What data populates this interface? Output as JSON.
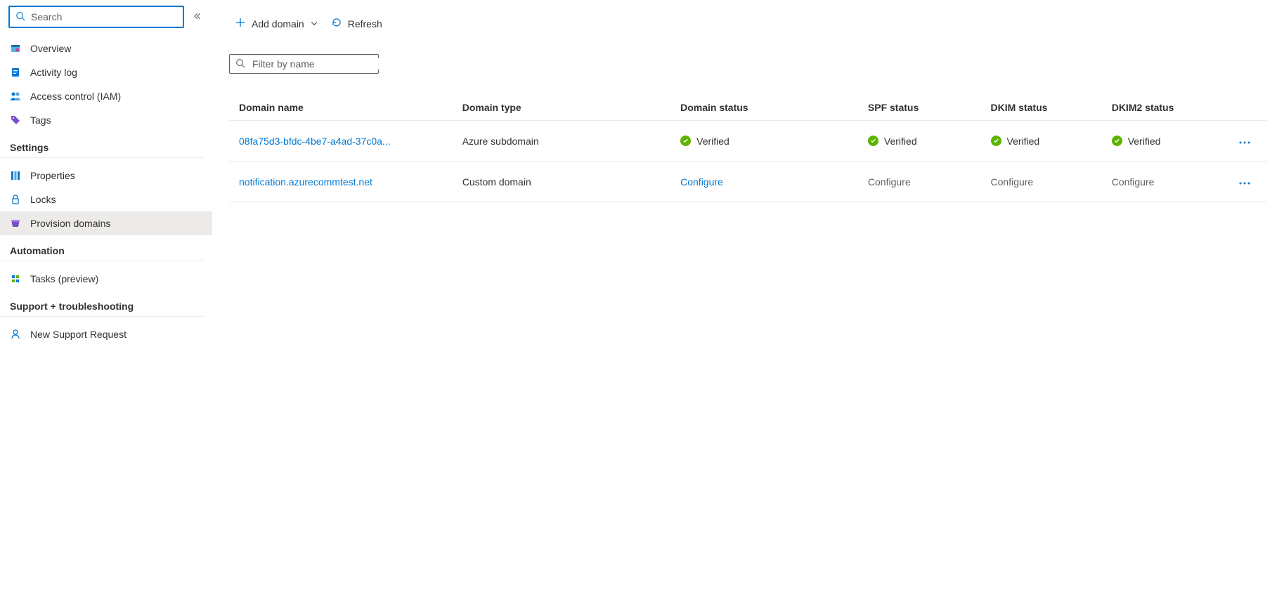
{
  "sidebar": {
    "search_placeholder": "Search",
    "top_items": [
      {
        "label": "Overview",
        "icon": "overview"
      },
      {
        "label": "Activity log",
        "icon": "log"
      },
      {
        "label": "Access control (IAM)",
        "icon": "iam"
      },
      {
        "label": "Tags",
        "icon": "tag"
      }
    ],
    "groups": [
      {
        "title": "Settings",
        "items": [
          {
            "label": "Properties",
            "icon": "properties"
          },
          {
            "label": "Locks",
            "icon": "lock"
          },
          {
            "label": "Provision domains",
            "icon": "domain",
            "active": true
          }
        ]
      },
      {
        "title": "Automation",
        "items": [
          {
            "label": "Tasks (preview)",
            "icon": "tasks"
          }
        ]
      },
      {
        "title": "Support + troubleshooting",
        "items": [
          {
            "label": "New Support Request",
            "icon": "support"
          }
        ]
      }
    ]
  },
  "toolbar": {
    "add_domain": "Add domain",
    "refresh": "Refresh"
  },
  "filter_placeholder": "Filter by name",
  "table": {
    "headers": {
      "name": "Domain name",
      "type": "Domain type",
      "domain_status": "Domain status",
      "spf": "SPF status",
      "dkim": "DKIM status",
      "dkim2": "DKIM2 status"
    },
    "rows": [
      {
        "name": "08fa75d3-bfdc-4be7-a4ad-37c0a...",
        "type": "Azure subdomain",
        "domain_status": {
          "label": "Verified",
          "kind": "verified"
        },
        "spf": {
          "label": "Verified",
          "kind": "verified"
        },
        "dkim": {
          "label": "Verified",
          "kind": "verified"
        },
        "dkim2": {
          "label": "Verified",
          "kind": "verified"
        }
      },
      {
        "name": "notification.azurecommtest.net",
        "type": "Custom domain",
        "domain_status": {
          "label": "Configure",
          "kind": "configure_link"
        },
        "spf": {
          "label": "Configure",
          "kind": "configure_muted"
        },
        "dkim": {
          "label": "Configure",
          "kind": "configure_muted"
        },
        "dkim2": {
          "label": "Configure",
          "kind": "configure_muted"
        }
      }
    ]
  }
}
